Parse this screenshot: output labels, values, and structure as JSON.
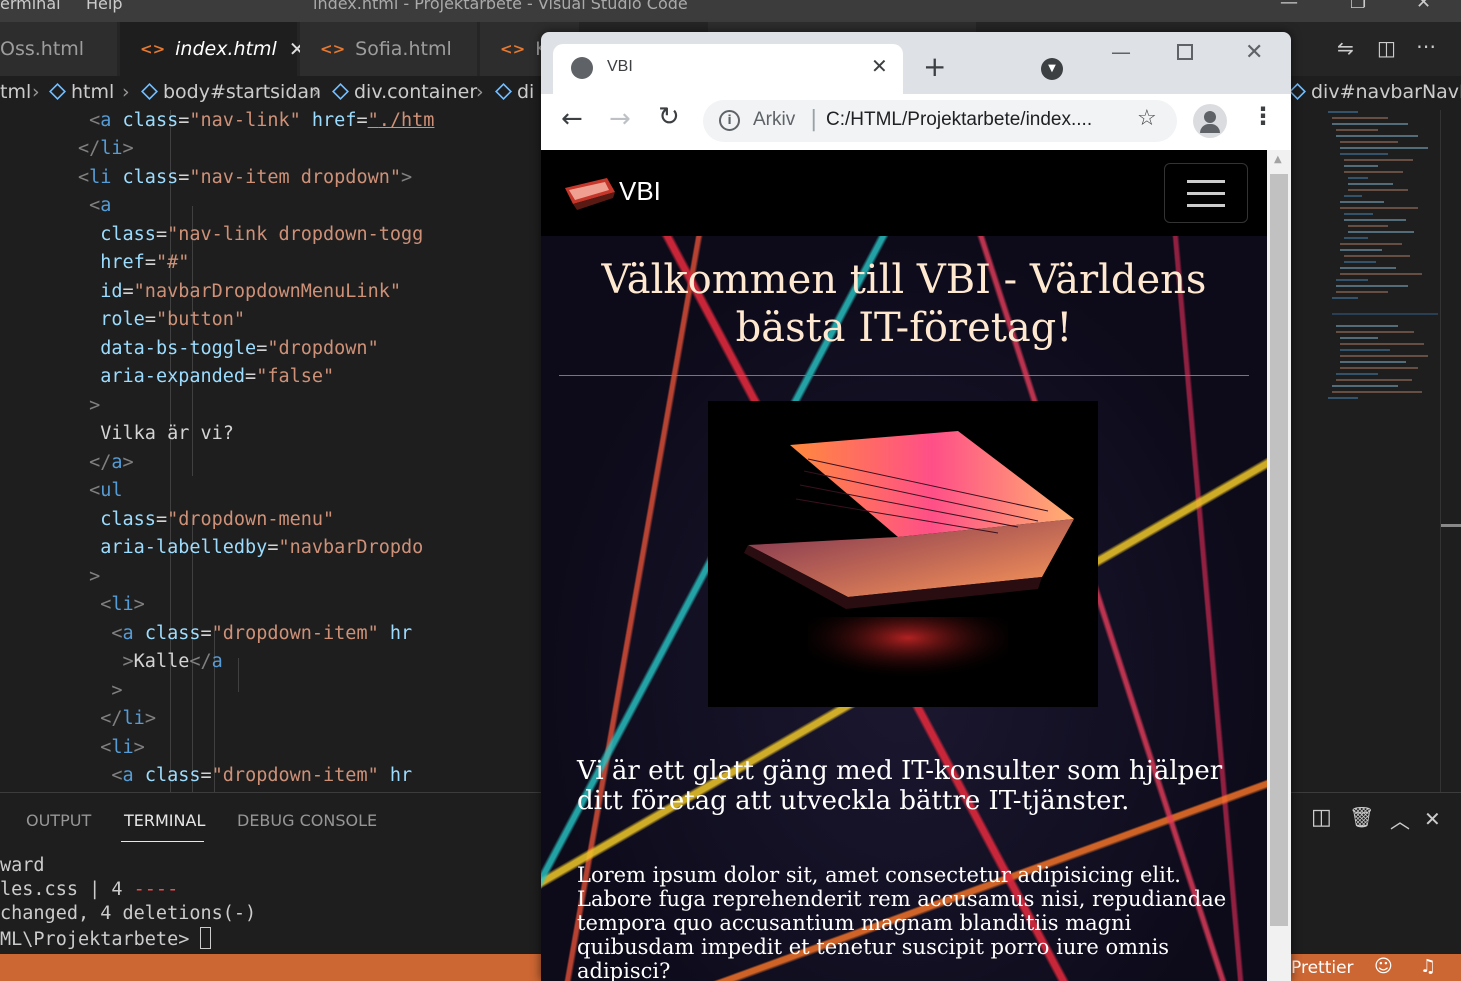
{
  "vscode": {
    "menu": [
      "erminal",
      "Help"
    ],
    "window_title": "index.html - Projektarbete - Visual Studio Code",
    "tabs": [
      {
        "label": "Oss.html"
      },
      {
        "label": "index.html",
        "active": true
      },
      {
        "label": "Sofia.html"
      },
      {
        "label": "K"
      }
    ],
    "breadcrumb": [
      "tml",
      "html",
      "body#startsidan",
      "div.container",
      "di"
    ],
    "breadcrumb_right": "div#navbarNavDr",
    "panel_tabs": [
      "OUTPUT",
      "TERMINAL",
      "DEBUG CONSOLE"
    ],
    "terminal_lines": {
      "l1": "ward",
      "l2a": "les.css | 4 ",
      "l2b": "----",
      "l3": "changed, 4 deletions(-)",
      "l4": "ML\\Projektarbete> "
    },
    "status_right": "Prettier",
    "accent": "#cc6633"
  },
  "code": {
    "l1_text": "./htm",
    "l8_val": "\"navbarDropdownMenuLink\"",
    "l9_val": "\"button\"",
    "l10_val": "\"dropdown\"",
    "l11_val": "\"false\"",
    "l13_text": "Vilka är vi?",
    "l16_val": "\"dropdown-menu\"",
    "l17_val": "\"navbarDropdo",
    "l20_val": "\"dropdown-item\"",
    "l21_text": "Kalle",
    "l25_val": "\"dropdown-item\""
  },
  "browser": {
    "tab_title": "VBI",
    "url_prefix": "Arkiv",
    "url": "C:/HTML/Projektarbete/index....",
    "site": {
      "brand": "VBI",
      "heading": "Välkommen till VBI - Världens bästa IT-företag!",
      "lead": "Vi är ett glatt gäng med IT-konsulter som hjälper ditt företag att utveckla bättre IT-tjänster.",
      "body": "Lorem ipsum dolor sit, amet consectetur adipisicing elit. Labore fuga reprehenderit rem accusamus nisi, repudiandae tempora quo accusantium magnam blanditiis magni quibusdam impedit et tenetur suscipit porro iure omnis adipisci?"
    }
  }
}
